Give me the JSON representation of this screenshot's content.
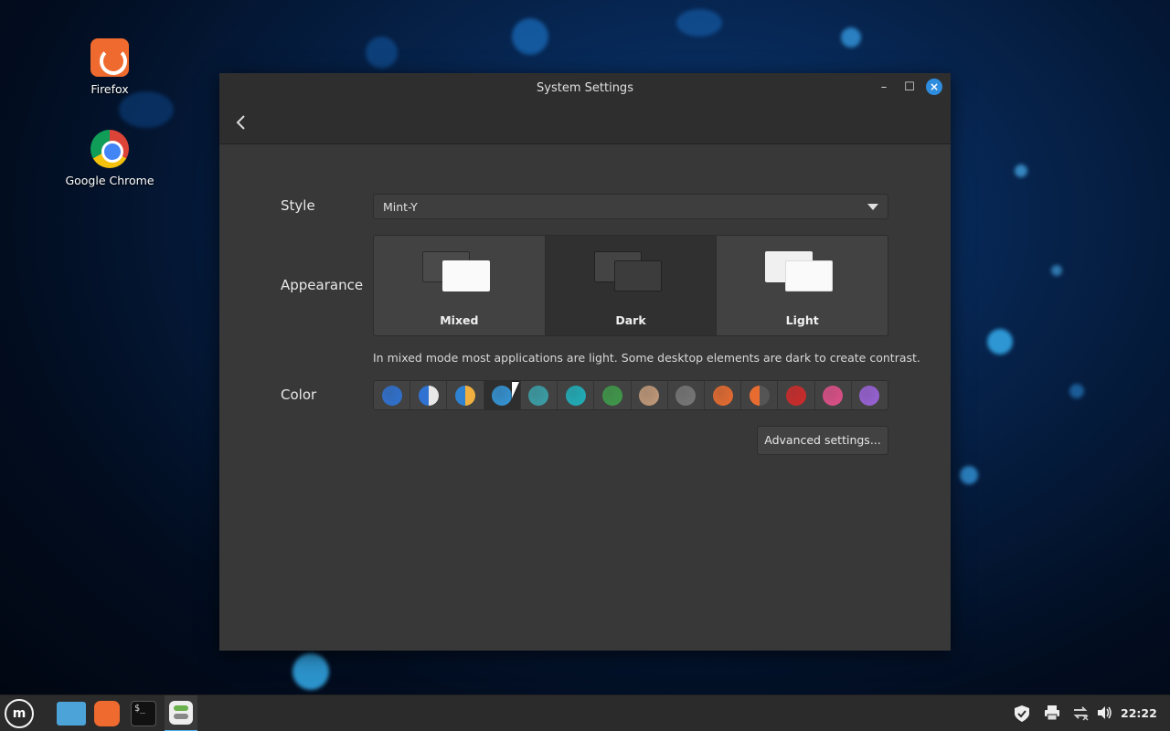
{
  "desktop": {
    "icons": [
      {
        "label": "Firefox"
      },
      {
        "label": "Google Chrome"
      }
    ]
  },
  "window": {
    "title": "System Settings",
    "style_label": "Style",
    "style_value": "Mint-Y",
    "appearance_label": "Appearance",
    "appearance_options": [
      {
        "label": "Mixed",
        "selected": false
      },
      {
        "label": "Dark",
        "selected": true
      },
      {
        "label": "Light",
        "selected": false
      }
    ],
    "hint": "In mixed mode most applications are light. Some desktop elements are dark to create contrast.",
    "color_label": "Color",
    "colors": [
      "#2f72d2",
      "split-blue-white",
      "split-blue-orange",
      "#3596d8",
      "#3aa0a8",
      "#1fb0bb",
      "#3f9a4a",
      "#c29a7a",
      "#777777",
      "#e86c30",
      "split-orange-gray",
      "#d02a2a",
      "#e0508a",
      "#9a62d8"
    ],
    "selected_color_index": 3,
    "advanced_button": "Advanced settings..."
  },
  "taskbar": {
    "menu_glyph": "m",
    "terminal_glyph": "$_",
    "clock": "22:22"
  }
}
